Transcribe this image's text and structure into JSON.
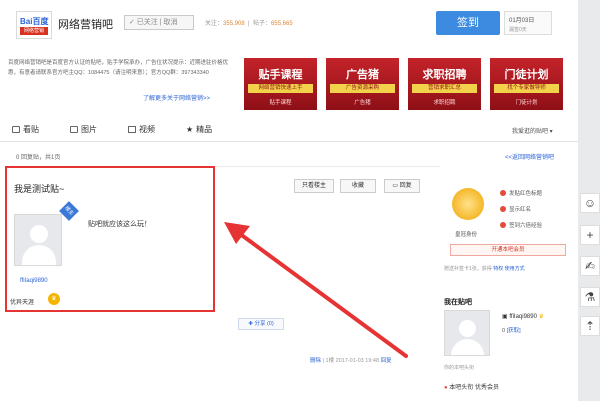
{
  "header": {
    "logo_top": "Bai百度",
    "logo_bottom": "网络营销",
    "forum_name": "网络营销吧",
    "follow_label": "✓ 已关注 | 取消",
    "follow_count_label": "关注：",
    "follow_count": "355,908",
    "post_count_label": "帖子：",
    "post_count": "655,665",
    "sign_label": "签到",
    "date": "01月03日",
    "date_sub": "漏签0天"
  },
  "intro": {
    "text": "百度网络营销吧是百度官方认证的贴吧，贴手学院承办，广告位状况提示：近期进驻价格优惠，有意者请联系官方吧主QQ：1084475（请注明来意）；官方QQ群：397343340",
    "link": "了解更多关于网络营销>>"
  },
  "banners": [
    {
      "title": "贴手课程",
      "slogan": "网络营销快速上手",
      "caption": "贴手课程"
    },
    {
      "title": "广告猪",
      "slogan": "广告资源采购",
      "caption": "广告猪"
    },
    {
      "title": "求职招聘",
      "slogan": "营销求职汇总",
      "caption": "求职招聘"
    },
    {
      "title": "门徒计划",
      "slogan": "找个专家做导师",
      "caption": "门徒计划"
    }
  ],
  "tabs": [
    {
      "label": "看贴"
    },
    {
      "label": "图片"
    },
    {
      "label": "视频"
    },
    {
      "label": "精品"
    }
  ],
  "tabs_right": "我爱逛的贴吧 ▾",
  "sub_info": "0 回复贴，共1页",
  "back_link": "<<返回网络营销吧",
  "post": {
    "title": "我是测试贴~",
    "only_op": "只看楼主",
    "collect": "收藏",
    "reply": "回复",
    "op_badge": "楼主",
    "username": "ffiIaqi9890",
    "rank": "优异天涯",
    "content": "贴吧就应该这么玩！",
    "share": "分享 (0)",
    "foot_report": "删除",
    "foot_floor": "1楼",
    "foot_time": "2017-01-03 19:48",
    "foot_reply": "回复"
  },
  "sidebar": {
    "crown_label": "皇冠身份",
    "perks": [
      "发贴红色标题",
      "显示红名",
      "签到六倍经验"
    ],
    "vip_button": "开通本吧会员",
    "info_text": "赠送补签卡1张，获得",
    "info_link": "特权 使用方式",
    "section_title": "我在贴吧",
    "username": "ffiIaqi9890",
    "user_sub_prefix": "0",
    "user_sub_link": "[获取]",
    "no_group": "你的本吧头衔",
    "bottom_text": "本吧头衔 优秀会员"
  },
  "tools": [
    "☺",
    "+",
    "✍",
    "⚗",
    "⇡"
  ],
  "colors": {
    "accent": "#3c8be0",
    "link": "#2d64d6",
    "highlight": "#e63333",
    "banner": "#c4232a"
  }
}
